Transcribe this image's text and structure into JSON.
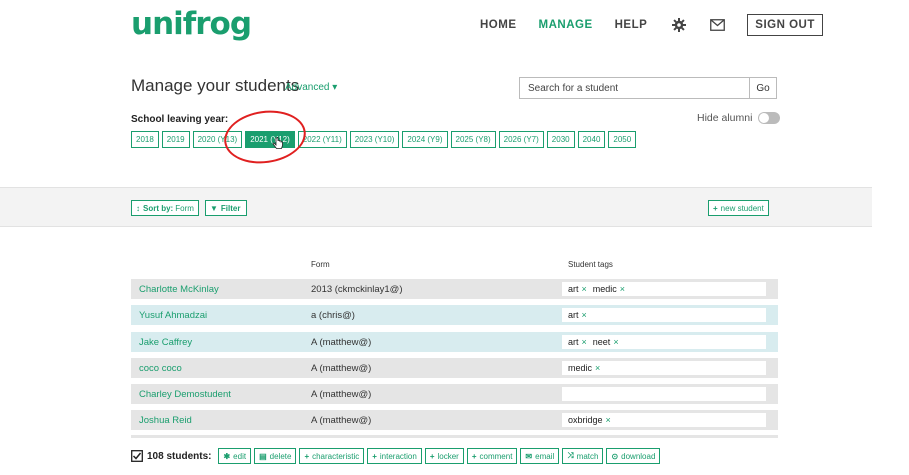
{
  "header": {
    "logo": "unifrog",
    "nav": {
      "home": "HOME",
      "manage": "MANAGE",
      "help": "HELP"
    },
    "settings_icon": "gear-icon",
    "mail_icon": "envelope-icon",
    "sign_out": "SIGN OUT"
  },
  "page": {
    "title": "Manage your students",
    "advanced": "Advanced ▾"
  },
  "search": {
    "placeholder": "Search for a student",
    "go": "Go"
  },
  "school_leaving": {
    "label": "School leaving year:",
    "years": [
      "2018",
      "2019",
      "2020 (Y13)",
      "2021 (Y12)",
      "2022 (Y11)",
      "2023 (Y10)",
      "2024 (Y9)",
      "2025 (Y8)",
      "2026 (Y7)",
      "2030",
      "2040",
      "2050"
    ],
    "selected": "2021 (Y12)"
  },
  "hide_alumni": {
    "label": "Hide alumni",
    "on": false
  },
  "toolbar": {
    "sort_label": "Sort by:",
    "sort_value": "Form",
    "filter": "Filter",
    "new_student": "new student"
  },
  "table": {
    "columns": {
      "form": "Form",
      "tags": "Student tags"
    },
    "rows": [
      {
        "name": "Charlotte McKinlay",
        "form": "2013 (ckmckinlay1@)",
        "tags": [
          "art",
          "medic"
        ]
      },
      {
        "name": "Yusuf Ahmadzai",
        "form": "a (chris@)",
        "tags": [
          "art"
        ]
      },
      {
        "name": "Jake Caffrey",
        "form": "A (matthew@)",
        "tags": [
          "art",
          "neet"
        ]
      },
      {
        "name": "coco coco",
        "form": "A (matthew@)",
        "tags": [
          "medic"
        ]
      },
      {
        "name": "Charley Demostudent",
        "form": "A (matthew@)",
        "tags": []
      },
      {
        "name": "Joshua Reid",
        "form": "A (matthew@)",
        "tags": [
          "oxbridge"
        ]
      }
    ]
  },
  "bulk": {
    "count": "108 students:",
    "actions": [
      "edit",
      "delete",
      "characteristic",
      "interaction",
      "locker",
      "comment",
      "email",
      "match",
      "download"
    ]
  },
  "colors": {
    "accent": "#1a9e6e",
    "highlight": "#e02020"
  }
}
